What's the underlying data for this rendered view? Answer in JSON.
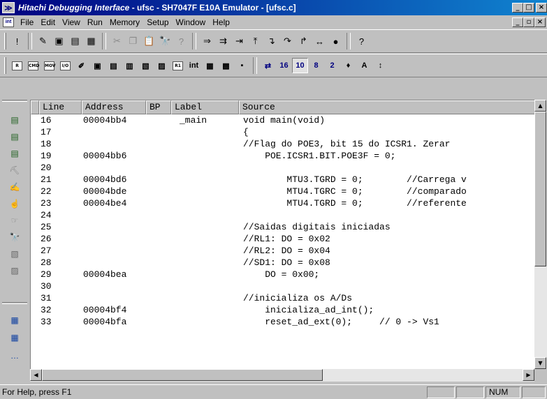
{
  "window": {
    "title_app": "Hitachi Debugging Interface",
    "title_rest": " - ufsc - SH7047F E10A Emulator - [ufsc.c]",
    "min": "_",
    "max": "□",
    "close": "×"
  },
  "menu": [
    "File",
    "Edit",
    "View",
    "Run",
    "Memory",
    "Setup",
    "Window",
    "Help"
  ],
  "mdi": {
    "min": "_",
    "restore": "▫",
    "close": "×"
  },
  "toolbar1": [
    {
      "name": "hint-icon",
      "glyph": "!"
    },
    {
      "name": "new-session-icon",
      "glyph": "✎"
    },
    {
      "name": "open-session-icon",
      "glyph": "▣"
    },
    {
      "name": "save-session-icon",
      "glyph": "▤"
    },
    {
      "name": "session-icon",
      "glyph": "▦"
    },
    {
      "name": "cut-icon",
      "glyph": "✂"
    },
    {
      "name": "copy-icon",
      "glyph": "❐"
    },
    {
      "name": "paste-icon",
      "glyph": "📋"
    },
    {
      "name": "find-icon",
      "glyph": "🔭"
    },
    {
      "name": "find-next-icon",
      "glyph": "?"
    },
    {
      "name": "go-icon",
      "glyph": "⇒"
    },
    {
      "name": "reset-go-icon",
      "glyph": "⇉"
    },
    {
      "name": "go-to-cursor-icon",
      "glyph": "⇥"
    },
    {
      "name": "set-pc-icon",
      "glyph": "⤒"
    },
    {
      "name": "step-in-icon",
      "glyph": "↴"
    },
    {
      "name": "step-over-icon",
      "glyph": "↷"
    },
    {
      "name": "step-out-icon",
      "glyph": "↱"
    },
    {
      "name": "step-icon",
      "glyph": "↔"
    },
    {
      "name": "stop-icon",
      "glyph": "●"
    },
    {
      "name": "help-icon",
      "glyph": "?"
    }
  ],
  "toolbar2": [
    {
      "name": "registers-icon",
      "glyph": "R"
    },
    {
      "name": "disassembly-icon",
      "glyph": "CMD"
    },
    {
      "name": "memory-icon",
      "glyph": "MOV"
    },
    {
      "name": "io-icon",
      "glyph": "I/O"
    },
    {
      "name": "breakpoints-icon",
      "glyph": "✐"
    },
    {
      "name": "watch-icon",
      "glyph": "▣"
    },
    {
      "name": "locals-icon",
      "glyph": "▤"
    },
    {
      "name": "labels-icon",
      "glyph": "▥"
    },
    {
      "name": "status-window-icon",
      "glyph": "▧"
    },
    {
      "name": "image-icon",
      "glyph": "▨"
    },
    {
      "name": "register-list-icon",
      "glyph": "R1"
    },
    {
      "name": "interrupt-icon",
      "glyph": "int"
    },
    {
      "name": "trace-icon",
      "glyph": "▦"
    },
    {
      "name": "profile-icon",
      "glyph": "▩"
    },
    {
      "name": "performance-icon",
      "glyph": "▪"
    },
    {
      "name": "radix-mixed-icon",
      "glyph": "⇄"
    },
    {
      "name": "radix-16-icon",
      "glyph": "16"
    },
    {
      "name": "radix-10-icon",
      "glyph": "10"
    },
    {
      "name": "radix-8-icon",
      "glyph": "8"
    },
    {
      "name": "radix-2-icon",
      "glyph": "2"
    },
    {
      "name": "symbol-icon",
      "glyph": "♦"
    },
    {
      "name": "ascii-icon",
      "glyph": "A"
    },
    {
      "name": "columns-icon",
      "glyph": "↕"
    }
  ],
  "source": {
    "headers": [
      "Line",
      "Address",
      "BP",
      "Label",
      "Source"
    ],
    "rows": [
      {
        "line": "16",
        "addr": "00004bb4",
        "label": "_main",
        "src": "void main(void)"
      },
      {
        "line": "17",
        "addr": "",
        "label": "",
        "src": "{"
      },
      {
        "line": "18",
        "addr": "",
        "label": "",
        "src": "//Flag do POE3, bit 15 do ICSR1. Zerar"
      },
      {
        "line": "19",
        "addr": "00004bb6",
        "label": "",
        "src": "    POE.ICSR1.BIT.POE3F = 0;"
      },
      {
        "line": "20",
        "addr": "",
        "label": "",
        "src": ""
      },
      {
        "line": "21",
        "addr": "00004bd6",
        "label": "",
        "src": "        MTU3.TGRD = 0;        //Carrega v"
      },
      {
        "line": "22",
        "addr": "00004bde",
        "label": "",
        "src": "        MTU4.TGRC = 0;        //comparado"
      },
      {
        "line": "23",
        "addr": "00004be4",
        "label": "",
        "src": "        MTU4.TGRD = 0;        //referente"
      },
      {
        "line": "24",
        "addr": "",
        "label": "",
        "src": ""
      },
      {
        "line": "25",
        "addr": "",
        "label": "",
        "src": "//Saidas digitais iniciadas"
      },
      {
        "line": "26",
        "addr": "",
        "label": "",
        "src": "//RL1: DO = 0x02"
      },
      {
        "line": "27",
        "addr": "",
        "label": "",
        "src": "//RL2: DO = 0x04"
      },
      {
        "line": "28",
        "addr": "",
        "label": "",
        "src": "//SD1: DO = 0x08"
      },
      {
        "line": "29",
        "addr": "00004bea",
        "label": "",
        "src": "    DO = 0x00;"
      },
      {
        "line": "30",
        "addr": "",
        "label": "",
        "src": ""
      },
      {
        "line": "31",
        "addr": "",
        "label": "",
        "src": "//inicializa os A/Ds"
      },
      {
        "line": "32",
        "addr": "00004bf4",
        "label": "",
        "src": "    inicializa_ad_int();"
      },
      {
        "line": "33",
        "addr": "00004bfa",
        "label": "",
        "src": "    reset_ad_ext(0);     // 0 -> Vs1"
      }
    ]
  },
  "leftstrip": [
    {
      "name": "source-window-icon",
      "glyph": "▤"
    },
    {
      "name": "disassembly-window-icon",
      "glyph": "▤"
    },
    {
      "name": "mixed-window-icon",
      "glyph": "▤"
    },
    {
      "name": "run-to-icon",
      "glyph": "⛏"
    },
    {
      "name": "modify-pc-icon",
      "glyph": "✍"
    },
    {
      "name": "watch-add-icon",
      "glyph": "☝"
    },
    {
      "name": "instant-watch-icon",
      "glyph": "☞"
    },
    {
      "name": "find-source-icon",
      "glyph": "🔭"
    },
    {
      "name": "trace-window-icon",
      "glyph": "▧"
    },
    {
      "name": "memory-window-icon",
      "glyph": "▨"
    },
    {
      "name": "register-window-icon",
      "glyph": "▦"
    },
    {
      "name": "grid-window-icon",
      "glyph": "▦"
    },
    {
      "name": "more-icon",
      "glyph": "…"
    }
  ],
  "status": {
    "message": "For Help, press F1",
    "num": "NUM"
  }
}
